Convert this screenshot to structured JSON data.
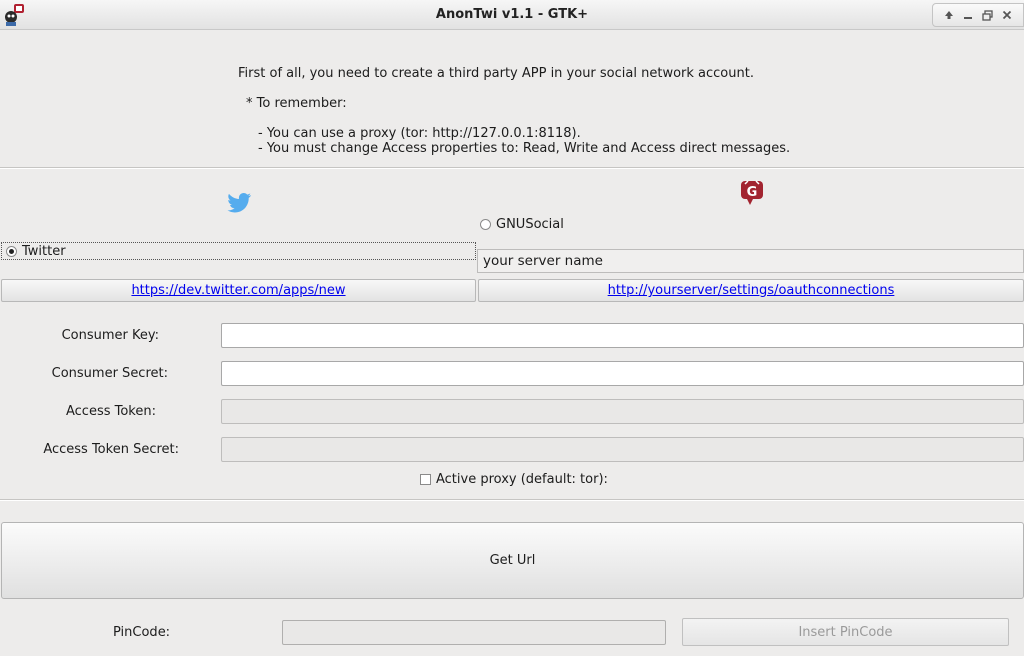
{
  "window": {
    "title": "AnonTwi v1.1 - GTK+"
  },
  "intro": {
    "line1": "First of all, you need to create a third party APP in your social network account.",
    "line2": "* To remember:",
    "line3": "- You can use a proxy (tor: http://127.0.0.1:8118).",
    "line4": "- You must change Access properties to: Read, Write and Access direct messages."
  },
  "network": {
    "twitter_label": "Twitter",
    "twitter_selected": true,
    "gnusocial_label": "GNUSocial",
    "gnusocial_selected": false,
    "server_name": "your server name",
    "twitter_link": "https://dev.twitter.com/apps/new",
    "gnusocial_link": "http://yourserver/settings/oauthconnections"
  },
  "form": {
    "consumer_key_label": "Consumer Key:",
    "consumer_secret_label": "Consumer Secret:",
    "access_token_label": "Access Token:",
    "access_token_secret_label": "Access Token Secret:",
    "proxy_label": "Active proxy (default: tor):",
    "proxy_checked": false
  },
  "actions": {
    "get_url_label": "Get Url",
    "pincode_label": "PinCode:",
    "insert_pincode_label": "Insert PinCode"
  },
  "colors": {
    "twitter_blue": "#55acee",
    "gnusocial_red": "#a22430",
    "link_blue": "#0000ee"
  }
}
